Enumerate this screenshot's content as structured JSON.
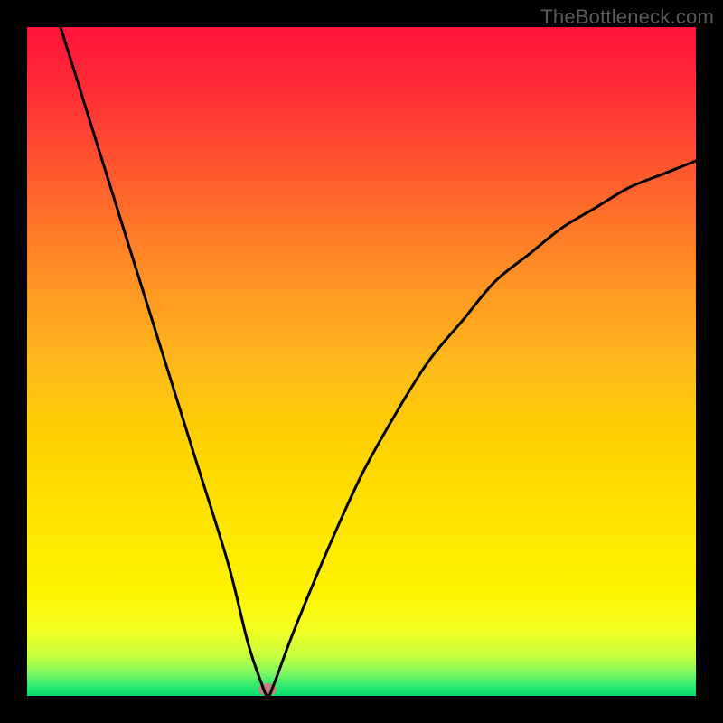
{
  "watermark": {
    "text": "TheBottleneck.com"
  },
  "chart_data": {
    "type": "line",
    "title": "",
    "xlabel": "",
    "ylabel": "",
    "xlim": [
      0,
      100
    ],
    "ylim": [
      0,
      100
    ],
    "grid": false,
    "legend": false,
    "background_gradient": {
      "top_color": "#ff1a3a",
      "mid_color": "#ffd000",
      "bottom_color": "#00e060"
    },
    "series": [
      {
        "name": "bottleneck-curve",
        "color": "#000000",
        "x": [
          5,
          10,
          15,
          20,
          25,
          30,
          33,
          35,
          36,
          37,
          40,
          45,
          50,
          55,
          60,
          65,
          70,
          75,
          80,
          85,
          90,
          95,
          100
        ],
        "y": [
          100,
          84,
          68,
          52,
          36,
          20,
          8,
          2,
          0,
          2,
          10,
          22,
          33,
          42,
          50,
          56,
          62,
          66,
          70,
          73,
          76,
          78,
          80
        ]
      }
    ],
    "marker": {
      "name": "optimal-point",
      "x": 36,
      "y": 0,
      "color": "#c97f7f"
    }
  }
}
